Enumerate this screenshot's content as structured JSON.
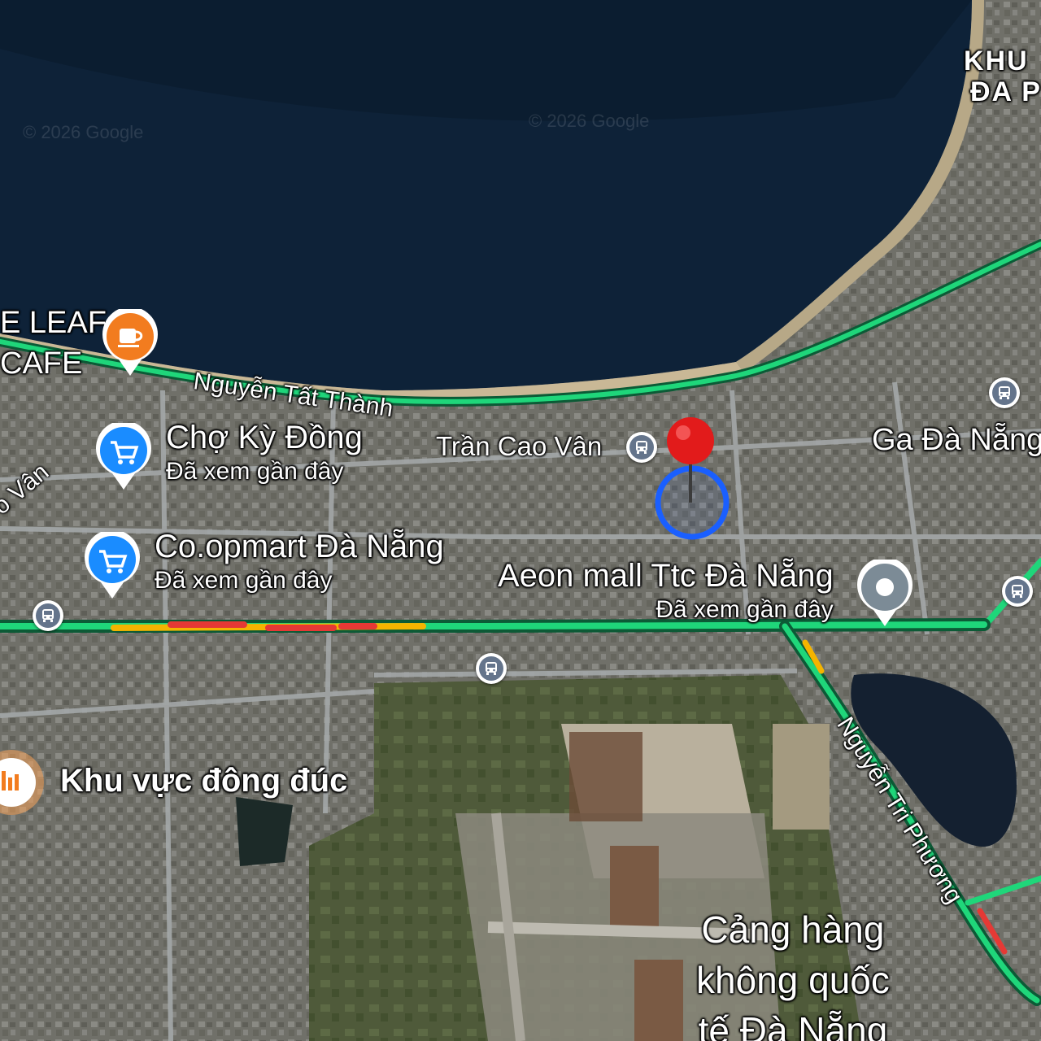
{
  "colors": {
    "water": "#0e2238",
    "land": "#76766f",
    "road": "#9aa0a2",
    "traffic_green": "#1fd67a",
    "traffic_yellow": "#f4b400",
    "traffic_red": "#e53935",
    "shopping_blue": "#1a8cff",
    "cafe_orange": "#f27c1f",
    "pin_red": "#e21b1b",
    "location_blue": "#1a5fff"
  },
  "watermarks": [
    "© 2026 Google",
    "© 2026 Google"
  ],
  "places": {
    "leaf_cafe": {
      "name_line1": "E LEAF",
      "name_line2": "CAFE",
      "icon": "coffee-cup-icon"
    },
    "cho_ky_dong": {
      "name": "Chợ Kỳ Đồng",
      "status": "Đã xem gần đây",
      "icon": "shopping-cart-icon"
    },
    "coopmart": {
      "name": "Co.opmart Đà Nẵng",
      "status": "Đã xem gần đây",
      "icon": "shopping-cart-icon"
    },
    "aeon": {
      "name": "Aeon mall Ttc Đà Nẵng",
      "status": "Đã xem gần đây",
      "icon": "place-dot-icon"
    },
    "ga_da_nang": {
      "name": "Ga Đà Nẵng"
    },
    "khu_dong_duc": {
      "name": "Khu vực đông đúc",
      "icon": "bar-chart-icon"
    },
    "airport": {
      "line1": "Cảng hàng",
      "line2": "không quốc",
      "line3": "tế Đà Nẵng"
    },
    "khu_top": {
      "line1": "KHU",
      "line2": "ĐA P"
    }
  },
  "roads": {
    "nguyen_tat_thanh": "Nguyễn Tất Thành",
    "tran_cao_van": "Trần Cao Vân",
    "nguyen_tri_phuong": "Nguyễn Tri Phương",
    "left_edge": "o Vân"
  },
  "markers": {
    "dropped_pin": "map-pin-icon",
    "location_circle": "location-circle-icon",
    "bus_stop": "bus-icon"
  }
}
